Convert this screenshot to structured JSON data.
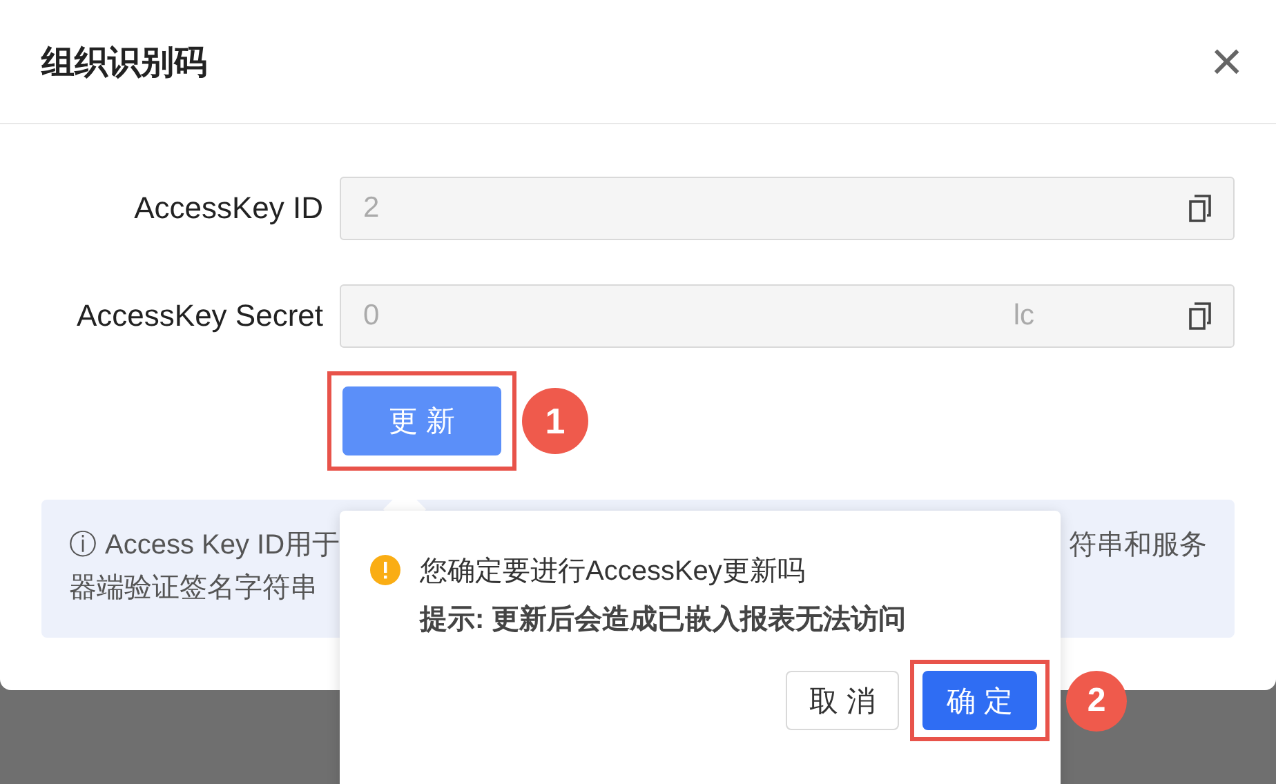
{
  "dialog": {
    "title": "组织识别码",
    "close_label": "×"
  },
  "fields": [
    {
      "label": "AccessKey ID",
      "value_parts": [
        "2"
      ]
    },
    {
      "label": "AccessKey Secret",
      "value_parts": [
        "0",
        "lc"
      ]
    }
  ],
  "update_button": {
    "label": "更 新",
    "annotation": "1"
  },
  "info": {
    "icon": "ⓘ",
    "left_lines": [
      "Access Key ID用于",
      "器端验证签名字符串"
    ],
    "right_lines": [
      "符串和服务"
    ]
  },
  "popconfirm": {
    "message": "您确定要进行AccessKey更新吗",
    "hint": "提示: 更新后会造成已嵌入报表无法访问",
    "cancel": "取 消",
    "confirm": "确 定",
    "annotation": "2"
  }
}
